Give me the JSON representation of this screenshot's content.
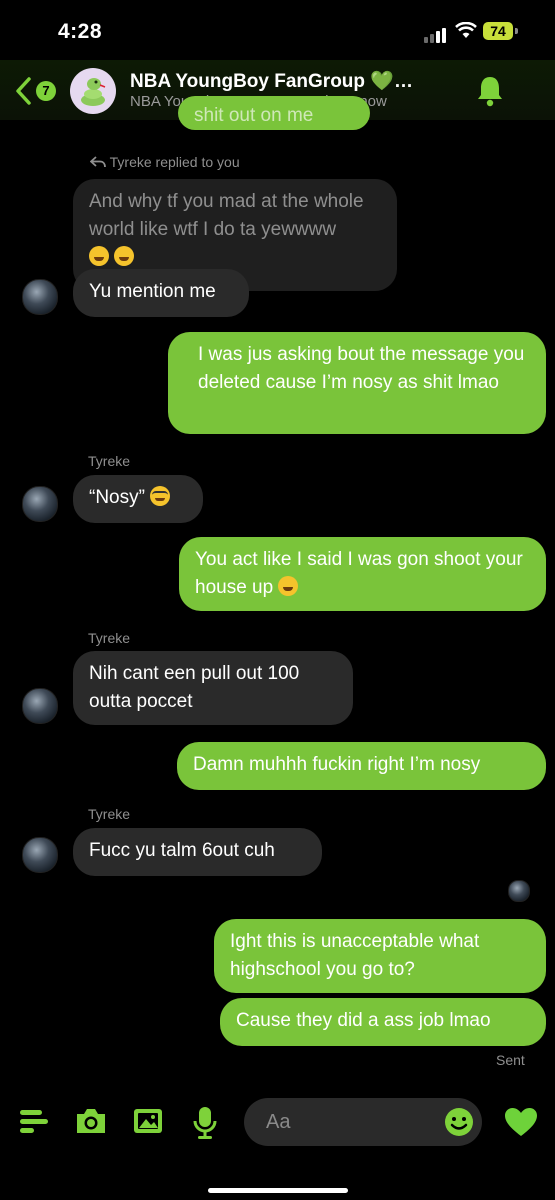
{
  "status_bar": {
    "time": "4:28",
    "battery": "74"
  },
  "header": {
    "back_count": "7",
    "title": "NBA YoungBoy FanGroup 💚…",
    "subtitle": "NBA Youngboy Fan Page · 2 here now",
    "icons": [
      "chevron-left-icon",
      "snake-avatar",
      "bell-icon"
    ]
  },
  "messages": {
    "partial_top": "shit out on me",
    "reply_header": "Tyreke replied to you",
    "quoted": "And why tf you mad at the whole world like wtf I do ta yewwww",
    "m1": "Yu mention me",
    "m2": "I was jus asking bout the message you deleted cause I’m nosy as shit lmao",
    "sender1": "Tyreke",
    "m3": "“Nosy”",
    "m4": "You act like I said I was gon shoot your house up",
    "sender2": "Tyreke",
    "m5": "Nih cant een pull out 100 outta poccet",
    "m6": "Damn muhhh fuckin right I’m nosy",
    "sender3": "Tyreke",
    "m7": "Fucc yu talm 6out cuh",
    "m8": "Ight this is unacceptable what highschool you go to?",
    "m9": "Cause they did a ass job lmao",
    "sent_status": "Sent"
  },
  "composer": {
    "placeholder": "Aa",
    "icons": [
      "menu-icon",
      "camera-icon",
      "image-icon",
      "microphone-icon",
      "emoji-icon",
      "heart-icon"
    ]
  },
  "colors": {
    "accent": "#7ac43a",
    "incoming_bubble": "#2a2a2a",
    "background": "#000000"
  }
}
